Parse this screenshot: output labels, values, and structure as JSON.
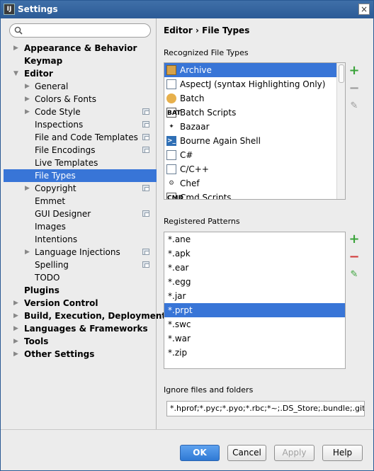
{
  "window": {
    "title": "Settings",
    "app_icon": "intellij-icon",
    "close_glyph": "×"
  },
  "search": {
    "placeholder": "",
    "value": ""
  },
  "tree": [
    {
      "label": "Appearance & Behavior",
      "level": 0,
      "arrow": "▶"
    },
    {
      "label": "Keymap",
      "level": 0,
      "arrow": ""
    },
    {
      "label": "Editor",
      "level": 0,
      "arrow": "▼"
    },
    {
      "label": "General",
      "level": 1,
      "arrow": "▶"
    },
    {
      "label": "Colors & Fonts",
      "level": 1,
      "arrow": "▶"
    },
    {
      "label": "Code Style",
      "level": 1,
      "arrow": "▶",
      "project": true
    },
    {
      "label": "Inspections",
      "level": 1,
      "arrow": "",
      "project": true
    },
    {
      "label": "File and Code Templates",
      "level": 1,
      "arrow": "",
      "project": true
    },
    {
      "label": "File Encodings",
      "level": 1,
      "arrow": "",
      "project": true
    },
    {
      "label": "Live Templates",
      "level": 1,
      "arrow": ""
    },
    {
      "label": "File Types",
      "level": 1,
      "arrow": "",
      "selected": true
    },
    {
      "label": "Copyright",
      "level": 1,
      "arrow": "▶",
      "project": true
    },
    {
      "label": "Emmet",
      "level": 1,
      "arrow": ""
    },
    {
      "label": "GUI Designer",
      "level": 1,
      "arrow": "",
      "project": true
    },
    {
      "label": "Images",
      "level": 1,
      "arrow": ""
    },
    {
      "label": "Intentions",
      "level": 1,
      "arrow": ""
    },
    {
      "label": "Language Injections",
      "level": 1,
      "arrow": "▶",
      "project": true
    },
    {
      "label": "Spelling",
      "level": 1,
      "arrow": "",
      "project": true
    },
    {
      "label": "TODO",
      "level": 1,
      "arrow": ""
    },
    {
      "label": "Plugins",
      "level": 0,
      "arrow": ""
    },
    {
      "label": "Version Control",
      "level": 0,
      "arrow": "▶"
    },
    {
      "label": "Build, Execution, Deployment",
      "level": 0,
      "arrow": "▶"
    },
    {
      "label": "Languages & Frameworks",
      "level": 0,
      "arrow": "▶"
    },
    {
      "label": "Tools",
      "level": 0,
      "arrow": "▶"
    },
    {
      "label": "Other Settings",
      "level": 0,
      "arrow": "▶"
    }
  ],
  "breadcrumb": {
    "parent": "Editor",
    "separator": "›",
    "current": "File Types"
  },
  "recognized": {
    "label": "Recognized File Types",
    "items": [
      {
        "label": "Archive",
        "icon": "archive-icon",
        "selected": true
      },
      {
        "label": "AspectJ (syntax Highlighting Only)",
        "icon": "aspectj-file-icon"
      },
      {
        "label": "Batch",
        "icon": "batch-icon"
      },
      {
        "label": "Batch Scripts",
        "icon": "bat-script-icon",
        "glyph": "BAT"
      },
      {
        "label": "Bazaar",
        "icon": "bazaar-icon",
        "glyph": "✦"
      },
      {
        "label": "Bourne Again Shell",
        "icon": "shell-icon",
        "glyph": ">_"
      },
      {
        "label": "C#",
        "icon": "csharp-file-icon"
      },
      {
        "label": "C/C++",
        "icon": "cpp-file-icon"
      },
      {
        "label": "Chef",
        "icon": "chef-icon",
        "glyph": "⚙"
      },
      {
        "label": "Cmd Scripts",
        "icon": "cmd-script-icon",
        "glyph": "CMD"
      }
    ]
  },
  "patterns": {
    "label": "Registered Patterns",
    "items": [
      {
        "label": "*.ane"
      },
      {
        "label": "*.apk"
      },
      {
        "label": "*.ear"
      },
      {
        "label": "*.egg"
      },
      {
        "label": "*.jar"
      },
      {
        "label": "*.prpt",
        "selected": true
      },
      {
        "label": "*.swc"
      },
      {
        "label": "*.war"
      },
      {
        "label": "*.zip"
      }
    ]
  },
  "ignore": {
    "label": "Ignore files and folders",
    "value": "*.hprof;*.pyc;*.pyo;*.rbc;*~;.DS_Store;.bundle;.git;.l"
  },
  "toolbar": {
    "add_glyph": "+",
    "remove_glyph": "−",
    "edit_glyph": "✎"
  },
  "buttons": {
    "ok": "OK",
    "cancel": "Cancel",
    "apply": "Apply",
    "help": "Help"
  },
  "colors": {
    "selection": "#3875d7",
    "titlebar": "#2c5b96",
    "add": "#3aa33a",
    "remove": "#d23b3b"
  }
}
